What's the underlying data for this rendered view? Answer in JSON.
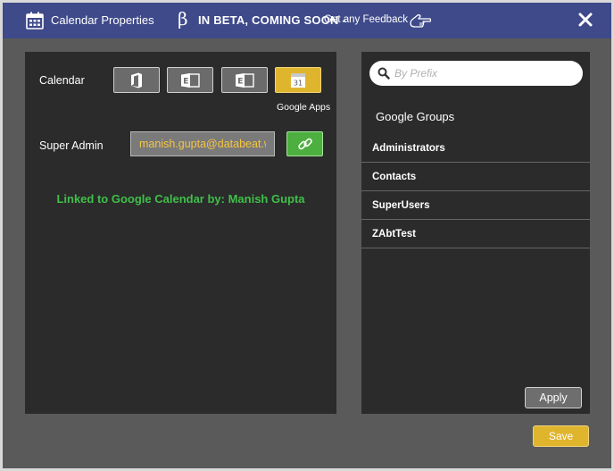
{
  "window": {
    "title": "Calendar Properties",
    "beta_symbol": "β",
    "beta_text": "IN BETA, COMING SOON -",
    "feedback_text": "Get any Feedback"
  },
  "calendar_section": {
    "calendar_label": "Calendar",
    "buttons": [
      {
        "icon": "office-icon",
        "active": false
      },
      {
        "icon": "exchange-icon",
        "active": false
      },
      {
        "icon": "exchange-icon",
        "active": false
      },
      {
        "icon": "google-calendar-icon",
        "active": true,
        "label": "31"
      }
    ],
    "selected_label": "Google Apps",
    "super_admin_label": "Super Admin",
    "super_admin_value": "manish.gupta@databeat.wo",
    "linked_text": "Linked to Google Calendar by: Manish Gupta"
  },
  "groups": {
    "search_placeholder": "By Prefix",
    "title": "Google Groups",
    "items": [
      "Administrators",
      "Contacts",
      "SuperUsers",
      "ZAbtTest"
    ],
    "apply_label": "Apply"
  },
  "footer": {
    "save_label": "Save"
  },
  "colors": {
    "titlebar": "#3f4a8a",
    "accent": "#e0b52e",
    "link_green": "#4caf3f",
    "linked_text": "#3fbf4a"
  }
}
